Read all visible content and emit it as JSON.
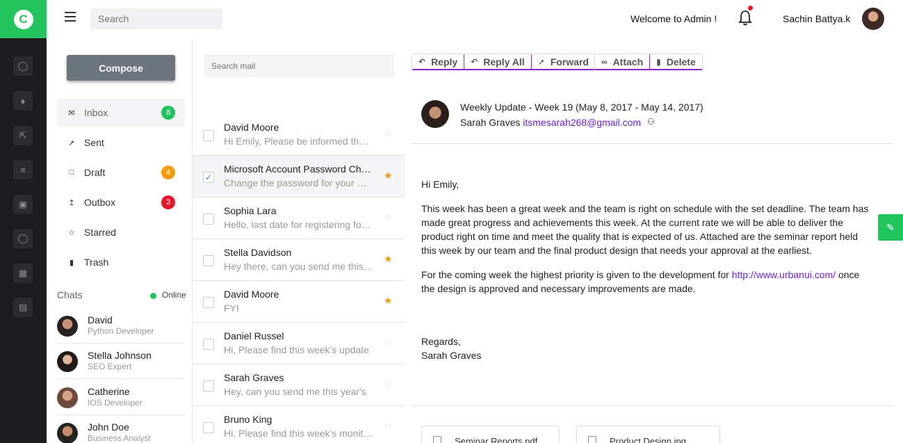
{
  "app": {
    "logo_letter": "C"
  },
  "header": {
    "search_placeholder": "Search",
    "welcome": "Welcome to Admin !",
    "user_name": "Sachin Battya.k"
  },
  "rail": {
    "icons": [
      "compass-icon",
      "puzzle-icon",
      "expand-icon",
      "list-icon",
      "lock-icon",
      "compass-icon",
      "widgets-icon",
      "cart-icon"
    ]
  },
  "sidebar": {
    "compose_label": "Compose",
    "folders": [
      {
        "label": "Inbox",
        "icon": "mail-icon",
        "badge": "8",
        "badge_color": "#21c35f"
      },
      {
        "label": "Sent",
        "icon": "send-icon",
        "badge": ""
      },
      {
        "label": "Draft",
        "icon": "draft-icon",
        "badge": "4",
        "badge_color": "#f39c12"
      },
      {
        "label": "Outbox",
        "icon": "upload-icon",
        "badge": "3",
        "badge_color": "#e8162b"
      },
      {
        "label": "Starred",
        "icon": "star-icon",
        "badge": ""
      },
      {
        "label": "Trash",
        "icon": "trash-icon",
        "badge": ""
      }
    ],
    "chats_title": "Chats",
    "online_label": "Online",
    "chats": [
      {
        "name": "David",
        "role": "Python Developer"
      },
      {
        "name": "Stella Johnson",
        "role": "SEO Expert"
      },
      {
        "name": "Catherine",
        "role": "IOS Developer"
      },
      {
        "name": "John Doe",
        "role": "Business Analyst"
      }
    ]
  },
  "mail_list": {
    "search_placeholder": "Search mail",
    "items": [
      {
        "from": "David Moore",
        "preview": "Hi Emily, Please be informed that the new project",
        "starred": false,
        "checked": false
      },
      {
        "from": "Microsoft Account Password Change",
        "preview": "Change the password for your Microsoft Account",
        "starred": true,
        "checked": true
      },
      {
        "from": "Sophia Lara",
        "preview": "Hello, last date for registering for the annual",
        "starred": false,
        "checked": false
      },
      {
        "from": "Stella Davidson",
        "preview": "Hey there, can you send me this year's",
        "starred": true,
        "checked": false
      },
      {
        "from": "David Moore",
        "preview": "FYI",
        "starred": true,
        "checked": false
      },
      {
        "from": "Daniel Russel",
        "preview": "Hi, Please find this week's update",
        "starred": false,
        "checked": false
      },
      {
        "from": "Sarah Graves",
        "preview": "Hey, can you send me this year's",
        "starred": false,
        "checked": false
      },
      {
        "from": "Bruno King",
        "preview": "Hi, Please find this week's monitoring",
        "starred": false,
        "checked": false
      }
    ]
  },
  "reader": {
    "actions_primary": [
      {
        "label": "Reply",
        "icon": "reply-icon"
      },
      {
        "label": "Reply All",
        "icon": "reply-all-icon"
      },
      {
        "label": "Forward",
        "icon": "forward-icon"
      }
    ],
    "actions_secondary": [
      {
        "label": "Attach",
        "icon": "paperclip-icon"
      },
      {
        "label": "Delete",
        "icon": "trash-icon"
      }
    ],
    "subject": "Weekly Update - Week 19 (May 8, 2017 - May 14, 2017)",
    "sender_name": "Sarah Graves",
    "sender_email": "itsmesarah268@gmail.com",
    "greeting": "Hi Emily,",
    "paragraph1": "This week has been a great week and the team is right on schedule with the set deadline. The team has made great progress and achievements this week. At the current rate we will be able to deliver the product right on time and meet the quality that is expected of us. Attached are the seminar report held this week by our team and the final product design that needs your approval at the earliest.",
    "paragraph2_before": "For the coming week the highest priority is given to the development for ",
    "paragraph2_link": "http://www.urbanui.com/",
    "paragraph2_after": " once the design is approved and necessary improvements are made.",
    "regards": "Regards,",
    "signature": "Sarah Graves",
    "attachments": [
      "Seminar Reports.pdf",
      "Product Design.jpg"
    ]
  }
}
